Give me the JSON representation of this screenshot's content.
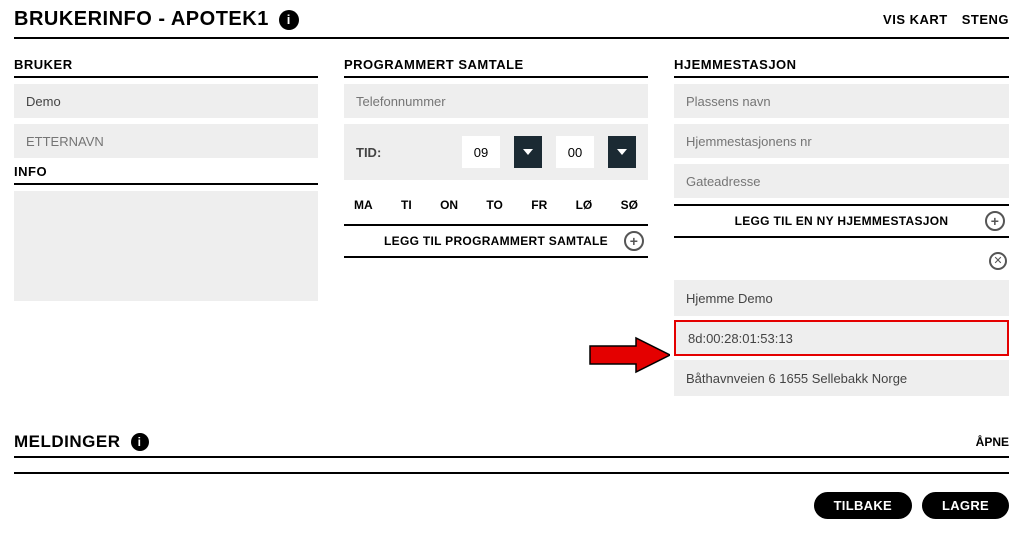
{
  "header": {
    "title": "BRUKERINFO - APOTEK1",
    "vis_kart": "VIS KART",
    "steng": "STENG"
  },
  "bruker": {
    "section": "BRUKER",
    "firstname": "Demo",
    "lastname_placeholder": "ETTERNAVN",
    "info_section": "INFO"
  },
  "samtale": {
    "section": "PROGRAMMERT SAMTALE",
    "phone_placeholder": "Telefonnummer",
    "tid_label": "TID:",
    "hour": "09",
    "minute": "00",
    "days": [
      "MA",
      "TI",
      "ON",
      "TO",
      "FR",
      "LØ",
      "SØ"
    ],
    "add_label": "LEGG TIL PROGRAMMERT SAMTALE"
  },
  "hjemmestasjon": {
    "section": "HJEMMESTASJON",
    "name_placeholder": "Plassens navn",
    "nr_placeholder": "Hjemmestasjonens nr",
    "addr_placeholder": "Gateadresse",
    "add_label": "LEGG TIL EN NY HJEMMESTASJON",
    "card": {
      "name": "Hjemme Demo",
      "mac": "8d:00:28:01:53:13",
      "address": "Båthavnveien 6 1655 Sellebakk Norge"
    }
  },
  "meldinger": {
    "title": "MELDINGER",
    "apne": "ÅPNE"
  },
  "footer": {
    "back": "TILBAKE",
    "save": "LAGRE"
  }
}
